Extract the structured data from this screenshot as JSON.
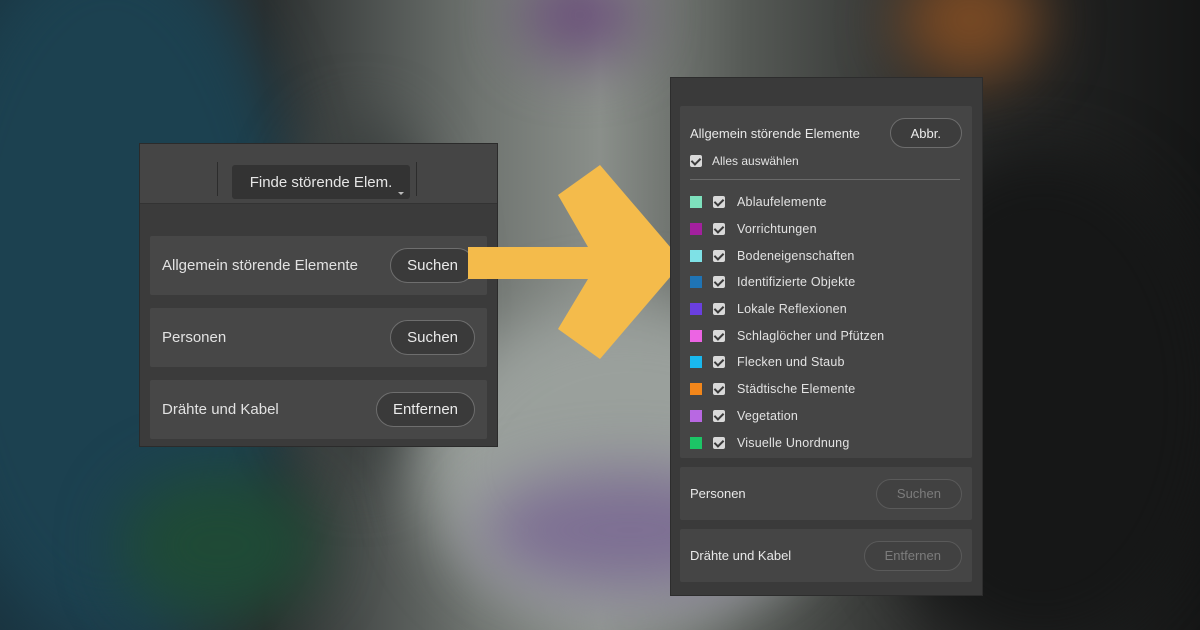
{
  "left_panel": {
    "find_button_label": "Finde störende Elem.",
    "rows": [
      {
        "label": "Allgemein störende Elemente",
        "button": "Suchen"
      },
      {
        "label": "Personen",
        "button": "Suchen"
      },
      {
        "label": "Drähte und Kabel",
        "button": "Entfernen"
      }
    ]
  },
  "right_panel": {
    "general": {
      "title": "Allgemein störende Elemente",
      "cancel_label": "Abbr.",
      "select_all_label": "Alles auswählen",
      "categories": [
        {
          "label": "Ablaufelemente",
          "color": "#7ee1bd"
        },
        {
          "label": "Vorrichtungen",
          "color": "#a3209e"
        },
        {
          "label": "Bodeneigenschaften",
          "color": "#7ee1e6"
        },
        {
          "label": "Identifizierte Objekte",
          "color": "#1f74b5"
        },
        {
          "label": "Lokale Reflexionen",
          "color": "#6a3fe0"
        },
        {
          "label": "Schlaglöcher und Pfützen",
          "color": "#ec64e3"
        },
        {
          "label": "Flecken und Staub",
          "color": "#19b8ee"
        },
        {
          "label": "Städtische Elemente",
          "color": "#f2861a"
        },
        {
          "label": "Vegetation",
          "color": "#b868e2"
        },
        {
          "label": "Visuelle Unordnung",
          "color": "#1cc566"
        }
      ]
    },
    "people": {
      "title": "Personen",
      "button": "Suchen"
    },
    "wires": {
      "title": "Drähte und Kabel",
      "button": "Entfernen"
    }
  },
  "colors": {
    "arrow": "#f4bb4b"
  }
}
